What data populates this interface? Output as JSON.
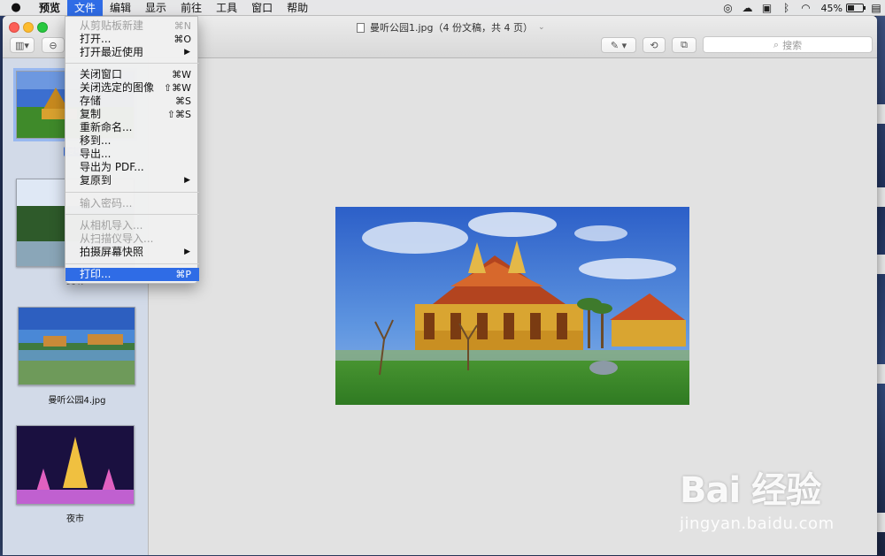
{
  "menubar": {
    "app_name": "预览",
    "items": [
      "文件",
      "编辑",
      "显示",
      "前往",
      "工具",
      "窗口",
      "帮助"
    ],
    "active_item": "文件",
    "battery_text": "45%",
    "battery_level": 0.45
  },
  "window": {
    "title": "曼听公园1.jpg（4 份文稿，共 4 页）",
    "search_placeholder": "搜索"
  },
  "file_menu": {
    "items": [
      {
        "label": "从剪贴板新建",
        "shortcut": "⌘N",
        "disabled": true
      },
      {
        "label": "打开...",
        "shortcut": "⌘O"
      },
      {
        "label": "打开最近使用",
        "submenu": true
      },
      {
        "label": "关闭窗口",
        "shortcut": "⌘W"
      },
      {
        "label": "关闭选定的图像",
        "shortcut": "⇧⌘W"
      },
      {
        "label": "存储",
        "shortcut": "⌘S"
      },
      {
        "label": "复制",
        "shortcut": "⇧⌘S"
      },
      {
        "label": "重新命名..."
      },
      {
        "label": "移到..."
      },
      {
        "label": "导出..."
      },
      {
        "label": "导出为 PDF..."
      },
      {
        "label": "复原到",
        "submenu": true
      },
      {
        "label": "输入密码...",
        "disabled": true
      },
      {
        "label": "从相机导入...",
        "disabled": true
      },
      {
        "label": "从扫描仪导入...",
        "disabled": true
      },
      {
        "label": "拍摄屏幕快照",
        "submenu": true
      },
      {
        "label": "打印...",
        "shortcut": "⌘P",
        "highlighted": true
      }
    ]
  },
  "sidebar": {
    "thumbnails": [
      {
        "label": "曼听公园1.jpg",
        "visible_label": "曼听",
        "selected": true
      },
      {
        "label": "曼听公园2.jpg",
        "visible_label": "曼听"
      },
      {
        "label": "曼听公园4.jpg",
        "visible_label": "曼听公园4.jpg"
      },
      {
        "label": "夜市",
        "visible_label": "夜市"
      }
    ]
  },
  "watermark": {
    "logo": "Bai  经验",
    "url": "jingyan.baidu.com"
  }
}
